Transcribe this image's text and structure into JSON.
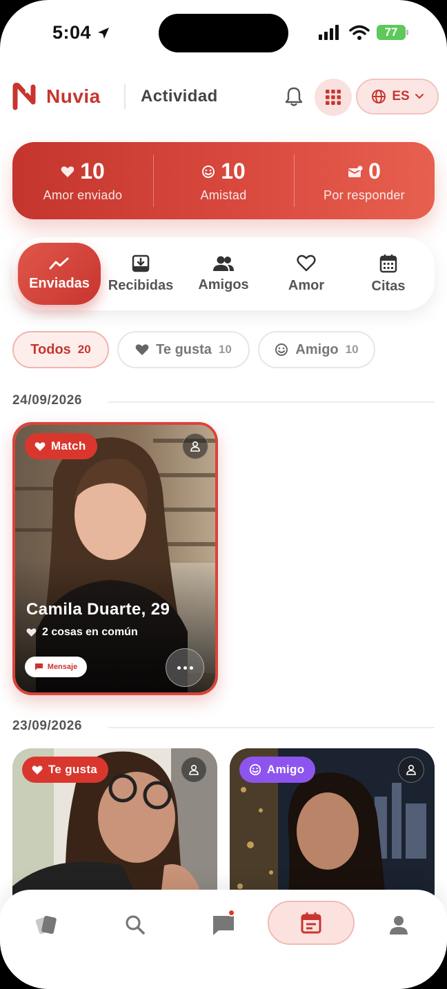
{
  "status_bar": {
    "time": "5:04",
    "battery": "77"
  },
  "header": {
    "brand": "Nuvia",
    "title": "Actividad",
    "language": "ES"
  },
  "stats": [
    {
      "icon": "heart-icon",
      "value": "10",
      "label": "Amor enviado"
    },
    {
      "icon": "smile-icon",
      "value": "10",
      "label": "Amistad"
    },
    {
      "icon": "mail-icon",
      "value": "0",
      "label": "Por responder"
    }
  ],
  "tabs": [
    {
      "icon": "trend-line-icon",
      "label": "Enviadas",
      "active": true
    },
    {
      "icon": "inbox-download-icon",
      "label": "Recibidas"
    },
    {
      "icon": "users-icon",
      "label": "Amigos"
    },
    {
      "icon": "heart-outline-icon",
      "label": "Amor"
    },
    {
      "icon": "calendar-icon",
      "label": "Citas"
    }
  ],
  "filters": [
    {
      "label": "Todos",
      "count": "20",
      "active": true
    },
    {
      "icon": "heart-icon",
      "label": "Te gusta",
      "count": "10"
    },
    {
      "icon": "smile-icon",
      "label": "Amigo",
      "count": "10"
    }
  ],
  "sections": [
    {
      "date": "24/09/2026",
      "cards": [
        {
          "badge": "Match",
          "name": "Camila Duarte, 29",
          "common": "2 cosas en común",
          "message_button": "Mensaje"
        }
      ]
    },
    {
      "date": "23/09/2026",
      "cards": [
        {
          "badge": "Te gusta"
        },
        {
          "badge": "Amigo"
        }
      ]
    }
  ],
  "bottom_nav": [
    {
      "icon": "cards-icon"
    },
    {
      "icon": "search-icon"
    },
    {
      "icon": "chat-icon",
      "has_notification": true
    },
    {
      "icon": "calendar-icon",
      "active": true
    },
    {
      "icon": "profile-icon"
    }
  ],
  "colors": {
    "accent": "#c8352e",
    "accent_light": "#fbe2df",
    "friend_badge": "#8e55ee"
  }
}
